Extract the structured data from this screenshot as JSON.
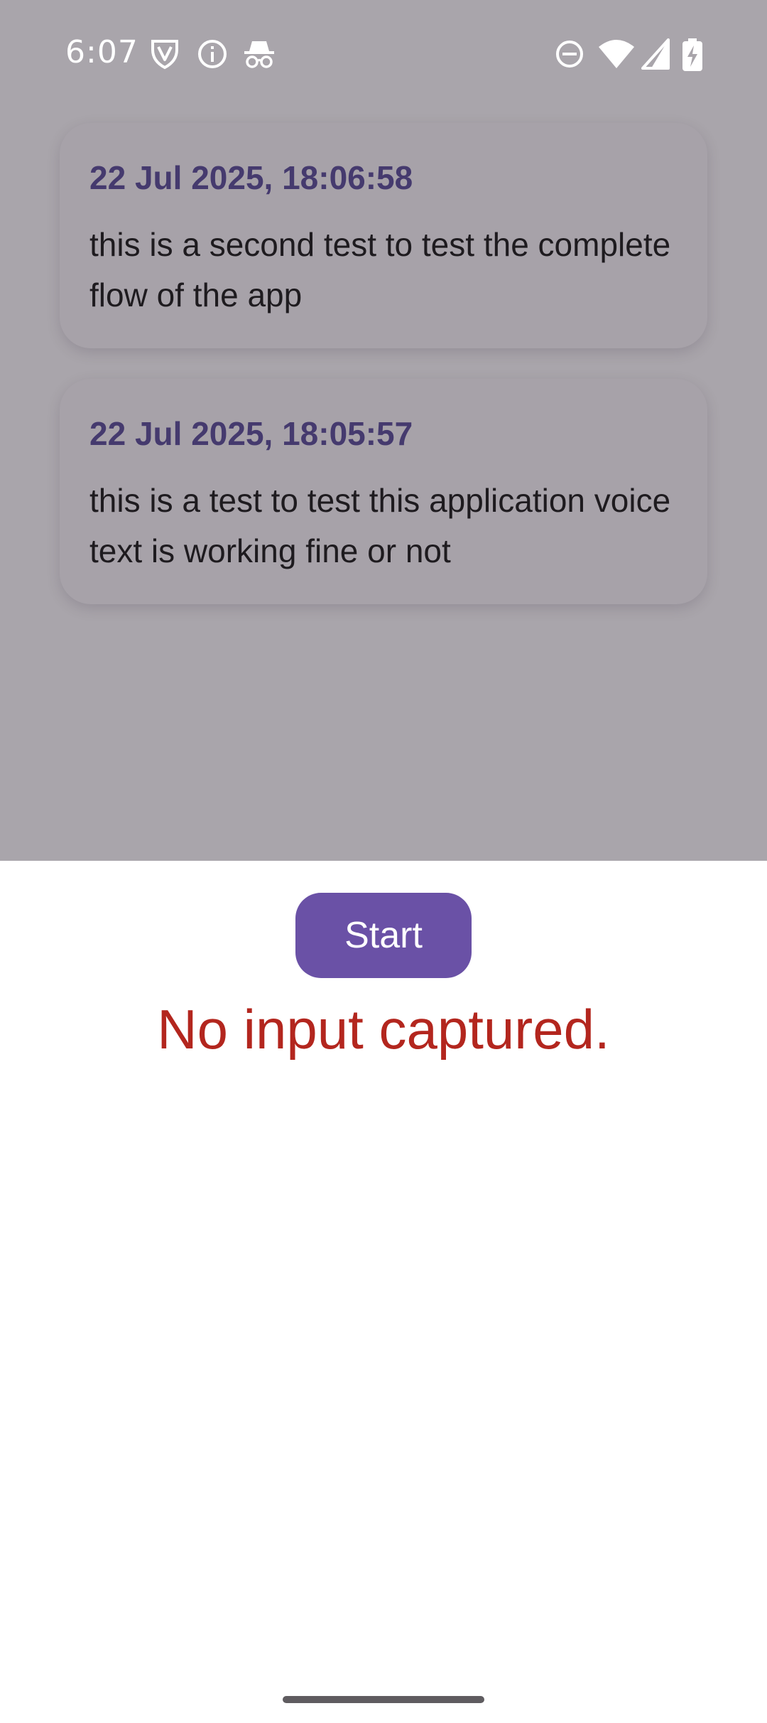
{
  "status_bar": {
    "time": "6:07",
    "left_icons": [
      "shield-v-icon",
      "info-icon",
      "incognito-icon"
    ],
    "right_icons": [
      "do-not-disturb-icon",
      "wifi-icon",
      "signal-icon",
      "battery-charging-icon"
    ]
  },
  "notes": [
    {
      "timestamp": "22 Jul 2025, 18:06:58",
      "text": "this is a second test to test the complete flow of the app"
    },
    {
      "timestamp": "22 Jul 2025, 18:05:57",
      "text": "this is a test to test this application voice text is working fine or not"
    }
  ],
  "sheet": {
    "start_label": "Start",
    "message": "No input captured."
  },
  "colors": {
    "scrim": "#a9a5ab",
    "accent": "#6a51a6",
    "date_text": "#453a6e",
    "error": "#b3261e"
  }
}
